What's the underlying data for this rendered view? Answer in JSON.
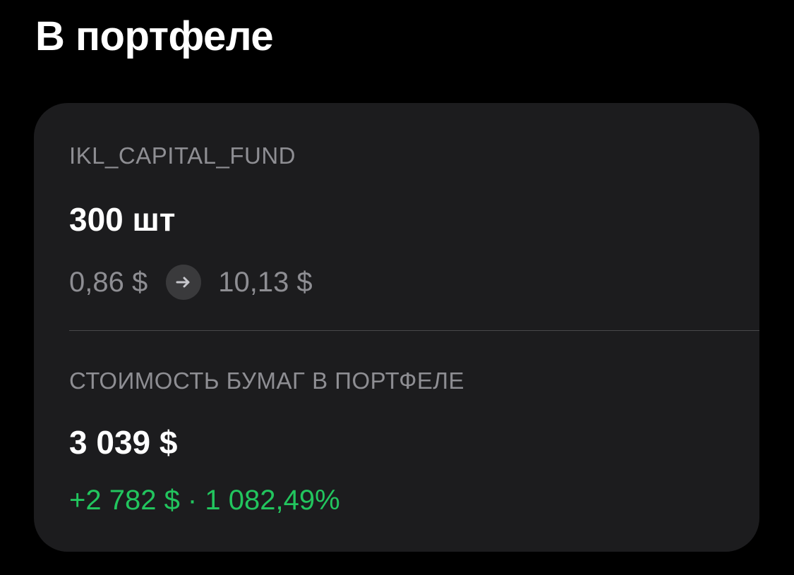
{
  "header": {
    "title": "В портфеле"
  },
  "position": {
    "ticker": "IKL_CAPITAL_FUND",
    "quantity": "300 шт",
    "buy_price": "0,86 $",
    "current_price": "10,13 $",
    "arrow_icon": "arrow-right-icon"
  },
  "portfolio_value": {
    "label": "СТОИМОСТЬ БУМАГ В ПОРТФЕЛЕ",
    "value": "3 039 $",
    "change": "+2 782 $ · 1 082,49%"
  },
  "colors": {
    "background": "#000000",
    "card": "#1c1c1e",
    "secondary_text": "#8e8e93",
    "positive": "#22c55e"
  }
}
